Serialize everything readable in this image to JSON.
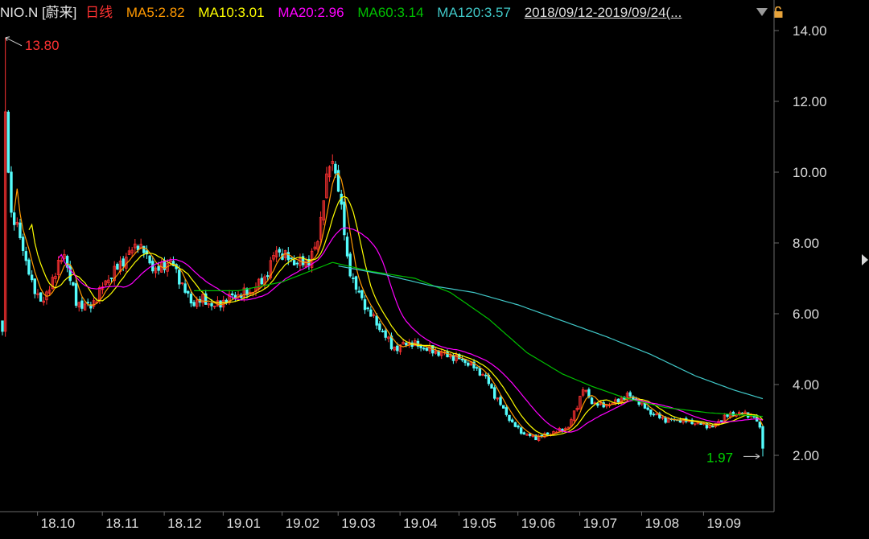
{
  "header": {
    "symbol": "NIO.N [蔚来]",
    "period": "日线",
    "ma5": "MA5:2.82",
    "ma10": "MA10:3.01",
    "ma20": "MA20:2.96",
    "ma60": "MA60:3.14",
    "ma120": "MA120:3.57",
    "date_range": "2018/09/12-2019/09/24(...",
    "icons": [
      "dropdown-triangle-icon",
      "lock-icon"
    ]
  },
  "colors": {
    "background": "#000000",
    "up": "#ff3232",
    "down": "#54fcfc",
    "ma5": "#ff9900",
    "ma10": "#ffff00",
    "ma20": "#ff00ff",
    "ma60": "#00c000",
    "ma120": "#40c8c8",
    "axis": "#6a6a6a",
    "label": "#dcdcdc"
  },
  "chart_data": {
    "type": "candlestick",
    "ylim": [
      1.5,
      14.6
    ],
    "yticks": [
      "14.00",
      "12.00",
      "10.00",
      "8.00",
      "6.00",
      "4.00",
      "2.00"
    ],
    "ytick_values": [
      14,
      12,
      10,
      8,
      6,
      4,
      2
    ],
    "xticks": [
      "18.10",
      "18.11",
      "18.12",
      "19.01",
      "19.02",
      "19.03",
      "19.04",
      "19.05",
      "19.06",
      "19.07",
      "19.08",
      "19.09"
    ],
    "xtick_index": [
      13,
      35,
      56,
      76,
      96,
      115,
      136,
      156,
      176,
      197,
      218,
      239
    ],
    "annotations": [
      {
        "text": "13.80",
        "bar": 0,
        "value": 13.8,
        "kind": "high"
      },
      {
        "text": "1.97",
        "bar": 258,
        "value": 1.97,
        "kind": "low"
      }
    ],
    "close_knots": [
      [
        0,
        6.0
      ],
      [
        1,
        11.6
      ],
      [
        3,
        8.8
      ],
      [
        6,
        8.2
      ],
      [
        10,
        6.8
      ],
      [
        14,
        6.3
      ],
      [
        17,
        7.0
      ],
      [
        21,
        7.7
      ],
      [
        25,
        6.3
      ],
      [
        30,
        6.2
      ],
      [
        35,
        6.9
      ],
      [
        40,
        7.4
      ],
      [
        46,
        8.0
      ],
      [
        52,
        7.2
      ],
      [
        57,
        7.5
      ],
      [
        60,
        7.0
      ],
      [
        64,
        6.3
      ],
      [
        68,
        6.4
      ],
      [
        72,
        6.2
      ],
      [
        78,
        6.5
      ],
      [
        84,
        6.6
      ],
      [
        89,
        7.0
      ],
      [
        93,
        7.8
      ],
      [
        98,
        7.5
      ],
      [
        103,
        7.4
      ],
      [
        107,
        8.0
      ],
      [
        109,
        9.4
      ],
      [
        111,
        10.2
      ],
      [
        113,
        10.1
      ],
      [
        115,
        9.0
      ],
      [
        117,
        7.5
      ],
      [
        120,
        6.7
      ],
      [
        124,
        6.1
      ],
      [
        128,
        5.6
      ],
      [
        132,
        5.1
      ],
      [
        134,
        5.0
      ],
      [
        137,
        5.2
      ],
      [
        141,
        5.1
      ],
      [
        144,
        5.0
      ],
      [
        148,
        4.9
      ],
      [
        152,
        4.8
      ],
      [
        156,
        4.7
      ],
      [
        160,
        4.5
      ],
      [
        164,
        4.2
      ],
      [
        167,
        3.7
      ],
      [
        170,
        3.3
      ],
      [
        173,
        2.9
      ],
      [
        177,
        2.6
      ],
      [
        181,
        2.5
      ],
      [
        185,
        2.6
      ],
      [
        189,
        2.7
      ],
      [
        192,
        2.8
      ],
      [
        195,
        3.4
      ],
      [
        197,
        3.9
      ],
      [
        200,
        3.5
      ],
      [
        204,
        3.4
      ],
      [
        208,
        3.5
      ],
      [
        212,
        3.7
      ],
      [
        216,
        3.5
      ],
      [
        220,
        3.2
      ],
      [
        225,
        3.0
      ],
      [
        230,
        3.0
      ],
      [
        236,
        2.9
      ],
      [
        241,
        2.8
      ],
      [
        245,
        3.1
      ],
      [
        250,
        3.2
      ],
      [
        255,
        3.1
      ],
      [
        258,
        2.6
      ]
    ],
    "ma60_knots": [
      [
        65,
        6.65
      ],
      [
        80,
        6.65
      ],
      [
        95,
        6.9
      ],
      [
        112,
        7.45
      ],
      [
        125,
        7.2
      ],
      [
        140,
        7.0
      ],
      [
        152,
        6.6
      ],
      [
        165,
        5.85
      ],
      [
        178,
        4.9
      ],
      [
        190,
        4.3
      ],
      [
        200,
        3.95
      ],
      [
        212,
        3.6
      ],
      [
        225,
        3.35
      ],
      [
        240,
        3.2
      ],
      [
        258,
        3.1
      ]
    ],
    "ma120_knots": [
      [
        114,
        7.35
      ],
      [
        130,
        7.1
      ],
      [
        145,
        6.8
      ],
      [
        160,
        6.6
      ],
      [
        175,
        6.25
      ],
      [
        190,
        5.8
      ],
      [
        205,
        5.35
      ],
      [
        220,
        4.85
      ],
      [
        235,
        4.25
      ],
      [
        248,
        3.85
      ],
      [
        258,
        3.6
      ]
    ]
  }
}
